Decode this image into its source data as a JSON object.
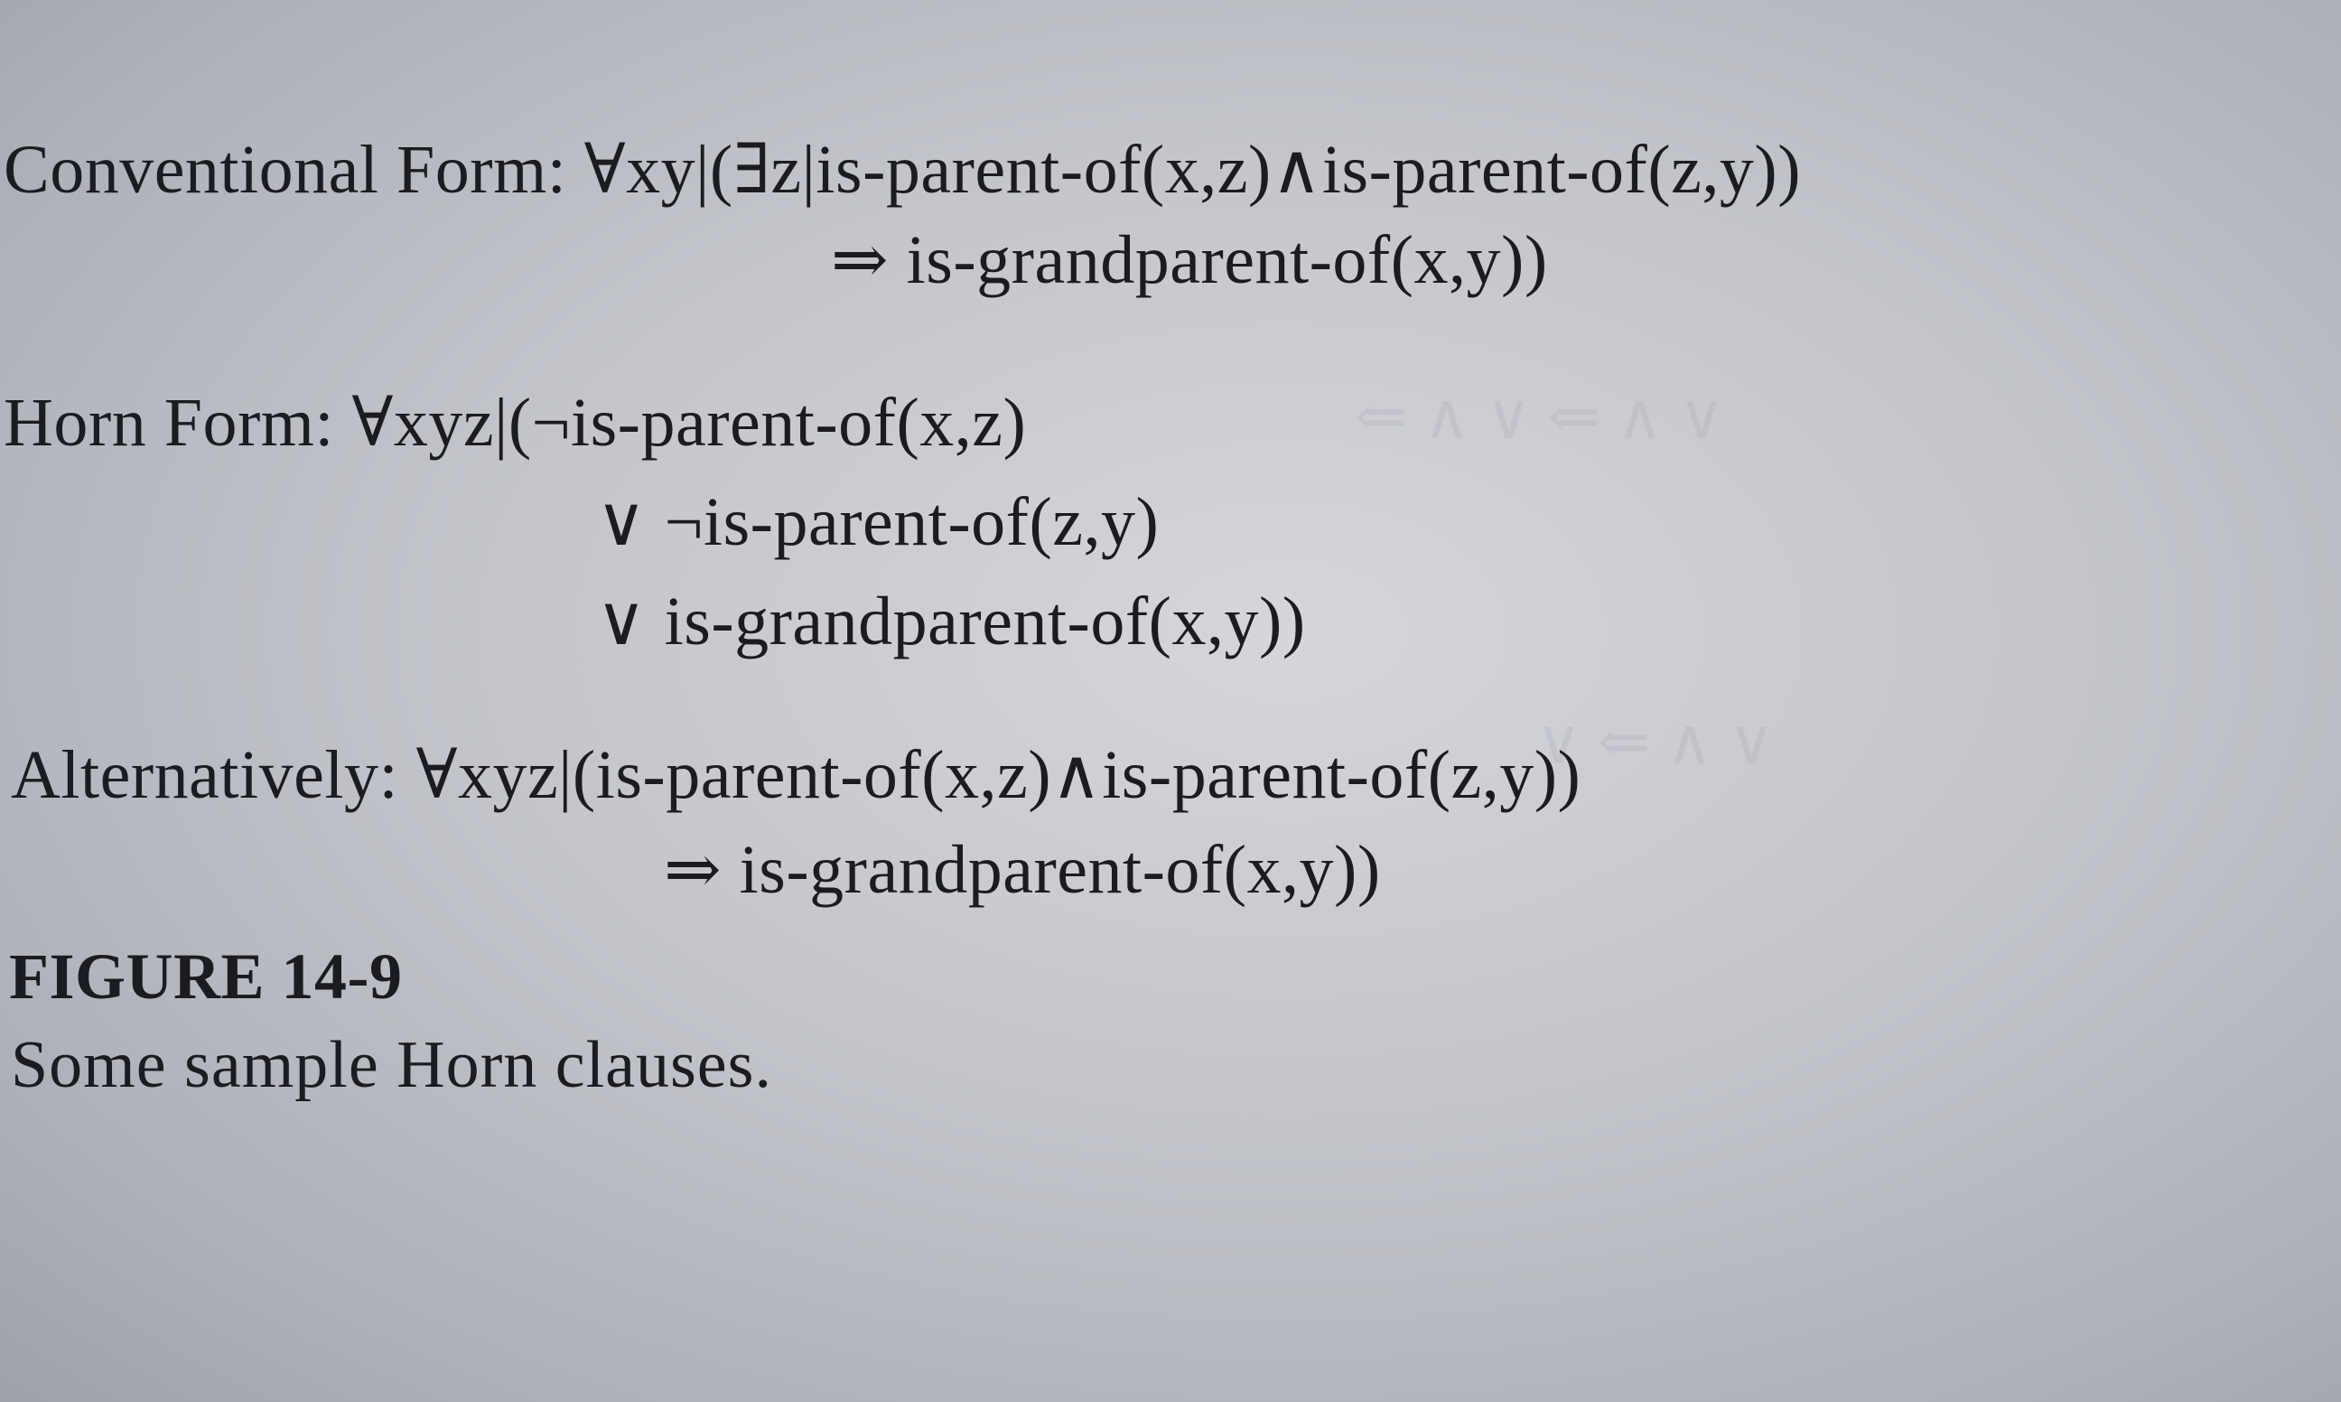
{
  "conventional": {
    "line1": "Conventional Form: ∀xy|(∃z|is-parent-of(x,z)∧is-parent-of(z,y))",
    "line2": "⇒ is-grandparent-of(x,y))"
  },
  "horn": {
    "line1": "Horn Form: ∀xyz|(¬is-parent-of(x,z)",
    "line2": "∨ ¬is-parent-of(z,y)",
    "line3": "∨ is-grandparent-of(x,y))"
  },
  "alternatively": {
    "line1": "Alternatively: ∀xyz|(is-parent-of(x,z)∧is-parent-of(z,y))",
    "line2": "⇒ is-grandparent-of(x,y))"
  },
  "figure": {
    "label": "FIGURE 14-9",
    "caption": "Some sample Horn clauses."
  }
}
